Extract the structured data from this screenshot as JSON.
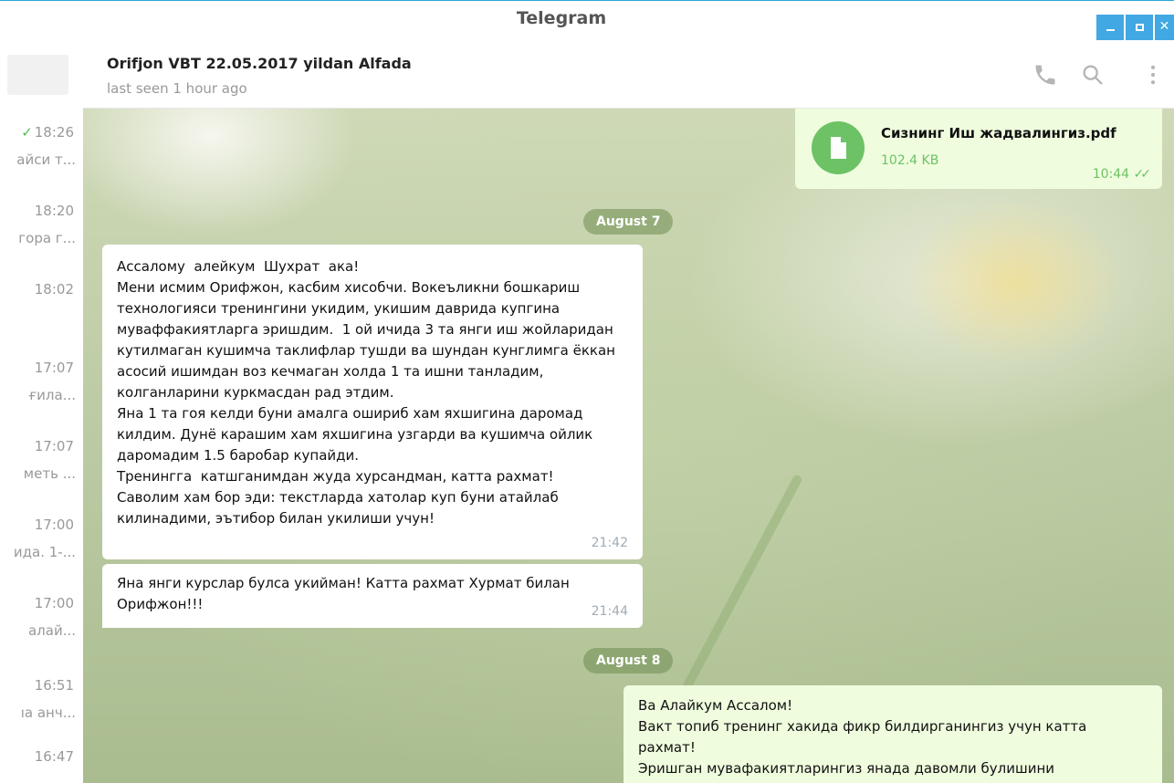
{
  "app": {
    "title": "Telegram"
  },
  "chat_list": [
    {
      "time": "18:26",
      "read": true,
      "preview": "айси т..."
    },
    {
      "time": "18:20",
      "preview": "гора г..."
    },
    {
      "time": "18:02",
      "preview": ""
    },
    {
      "time": "17:07",
      "preview": "ғила..."
    },
    {
      "time": "17:07",
      "preview": "меть ..."
    },
    {
      "time": "17:00",
      "preview": "ида. 1-..."
    },
    {
      "time": "17:00",
      "preview": "алай..."
    },
    {
      "time": "16:51",
      "preview": "ıа анч..."
    },
    {
      "time": "16:47",
      "preview": ""
    }
  ],
  "header": {
    "peer_name": "Orifjon VBT 22.05.2017 yildan Alfada",
    "status": "last seen 1 hour ago",
    "icons": [
      "phone-icon",
      "search-icon",
      "more-vertical-icon"
    ]
  },
  "messages": {
    "file": {
      "name": "Сизнинг Иш жадвалингиз.pdf",
      "size": "102.4 KB",
      "time": "10:44",
      "status": "read"
    },
    "date1": "August 7",
    "msg1": {
      "text": "Ассалому  алейкум  Шухрат  ака!\nМени исмим Орифжон, касбим хисобчи. Вокеъликни бошкариш технологияси тренингини укидим, укишим даврида купгина муваффакиятларга эришдим.  1 ой ичида 3 та янги иш жойларидан кутилмаган кушимча таклифлар тушди ва шундан кунглимга ёккан асосий ишимдан воз кечмаган холда 1 та ишни танладим, колганларини куркмасдан рад этдим.\nЯна 1 та гоя келди буни амалга ошириб хам яхшигина даромад килдим. Дунё карашим хам яхшигина узгарди ва кушимча ойлик даромадим 1.5 баробар купайди.\nТренингга  катшганимдан жуда хурсандман, катта рахмат!\nСаволим хам бор эди: текстларда хатолар куп буни атайлаб килинадими, эътибор билан укилиши учун!",
      "time": "21:42"
    },
    "msg2": {
      "text": "Яна янги курслар булса укийман! Катта рахмат Хурмат билан Орифжон!!!",
      "time": "21:44"
    },
    "date2": "August 8",
    "msg3": {
      "text": "Ва Алайкум Ассалом!\nВакт топиб тренинг хакида фикр билдирганингиз учун катта рахмат!\nЭришган мувафакиятларингиз янада давомли булишини"
    }
  }
}
